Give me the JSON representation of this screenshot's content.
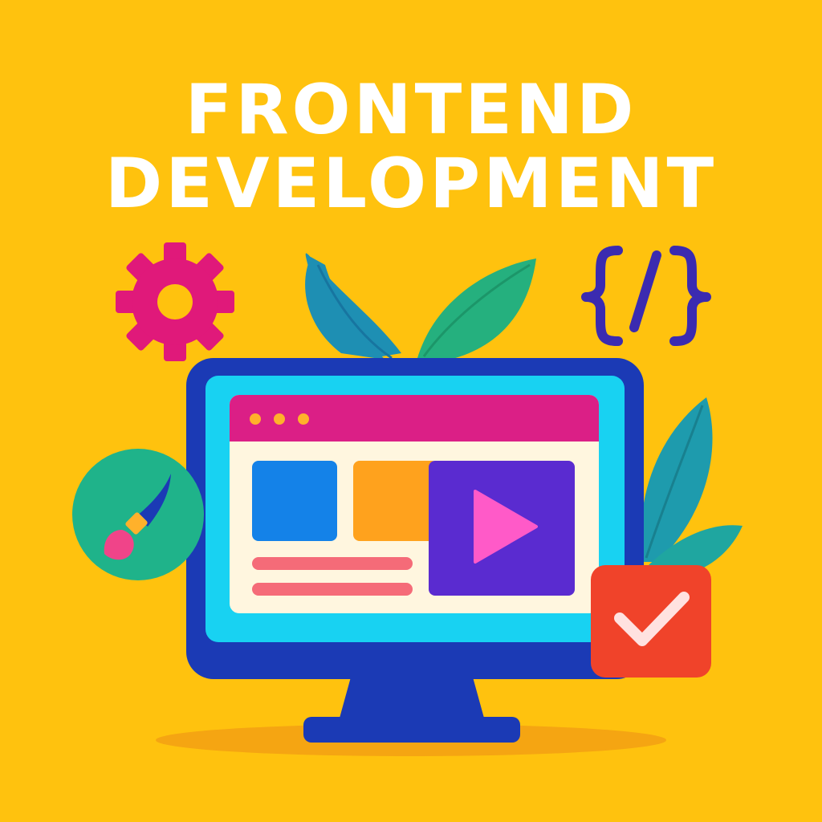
{
  "title": {
    "line1": "FRONTEND",
    "line2": "DEVELOPMENT"
  },
  "icons": [
    "gear-icon",
    "code-brackets-icon",
    "paintbrush-icon",
    "play-icon",
    "checkmark-icon",
    "leaf-decoration",
    "monitor-illustration"
  ],
  "colors": {
    "background": "#FFC20E",
    "monitor_frame": "#1B3AB5",
    "screen": "#18D2F2",
    "browser_header": "#DB1F86",
    "gear": "#E0197A",
    "code": "#3B2BB0",
    "check_badge": "#F0432A",
    "palette_circle": "#1FB38A",
    "video_panel": "#5A2BD0",
    "play": "#FF5AC8"
  }
}
